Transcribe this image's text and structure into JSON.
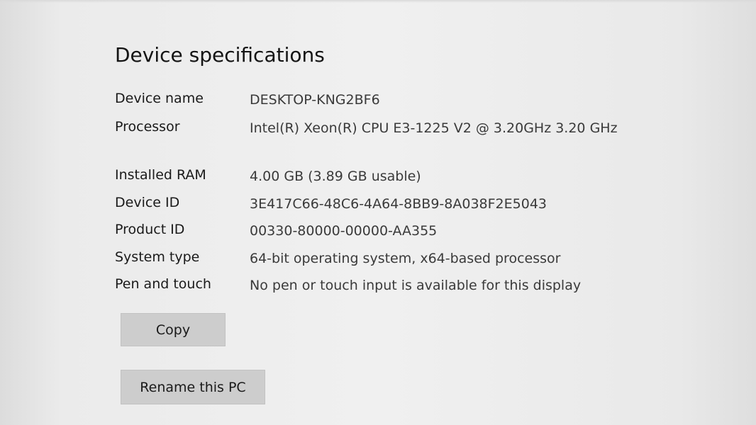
{
  "section": {
    "title": "Device specifications"
  },
  "specs": [
    {
      "label": "Device name",
      "value": "DESKTOP-KNG2BF6"
    },
    {
      "label": "Processor",
      "value": "Intel(R) Xeon(R) CPU E3-1225 V2 @ 3.20GHz   3.20 GHz"
    },
    {
      "label": "Installed RAM",
      "value": "4.00 GB (3.89 GB usable)"
    },
    {
      "label": "Device ID",
      "value": "3E417C66-48C6-4A64-8BB9-8A038F2E5043"
    },
    {
      "label": "Product ID",
      "value": "00330-80000-00000-AA355"
    },
    {
      "label": "System type",
      "value": "64-bit operating system, x64-based processor"
    },
    {
      "label": "Pen and touch",
      "value": "No pen or touch input is available for this display"
    }
  ],
  "buttons": {
    "copy": "Copy",
    "rename": "Rename this PC"
  }
}
